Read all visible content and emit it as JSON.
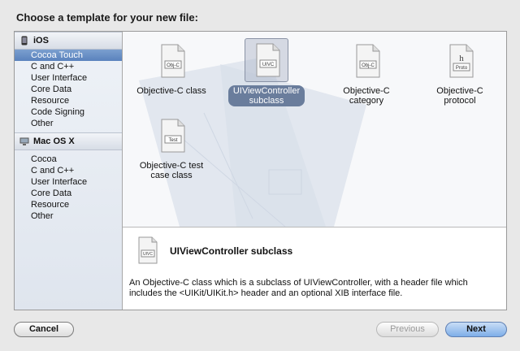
{
  "dialog": {
    "title": "Choose a template for your new file:"
  },
  "sidebar": {
    "sections": [
      {
        "header": "iOS",
        "items": [
          "Cocoa Touch",
          "C and C++",
          "User Interface",
          "Core Data",
          "Resource",
          "Code Signing",
          "Other"
        ]
      },
      {
        "header": "Mac OS X",
        "items": [
          "Cocoa",
          "C and C++",
          "User Interface",
          "Core Data",
          "Resource",
          "Other"
        ]
      }
    ],
    "selected": "Cocoa Touch"
  },
  "templates": [
    {
      "label": "Objective-C class",
      "badge": "Obj-C"
    },
    {
      "label_line1": "UIViewController",
      "label_line2": "subclass",
      "badge": "UIVC"
    },
    {
      "label_line1": "Objective-C",
      "label_line2": "category",
      "badge": "Obj-C"
    },
    {
      "label": "Objective-C protocol",
      "badge": "Proto",
      "glyph": "h"
    },
    {
      "label_line1": "Objective-C test",
      "label_line2": "case class",
      "badge": "Test"
    }
  ],
  "selected_template": "UIViewController subclass",
  "description": {
    "title": "UIViewController subclass",
    "badge": "UIVC",
    "text": "An Objective-C class which is a subclass of UIViewController, with a header file which includes the <UIKit/UIKit.h> header and an optional XIB interface file."
  },
  "buttons": {
    "cancel": "Cancel",
    "previous": "Previous",
    "next": "Next"
  },
  "colors": {
    "selection": "#5a82bd",
    "tile_selection": "#6a7d9c",
    "default_button": "#7eaee8"
  }
}
